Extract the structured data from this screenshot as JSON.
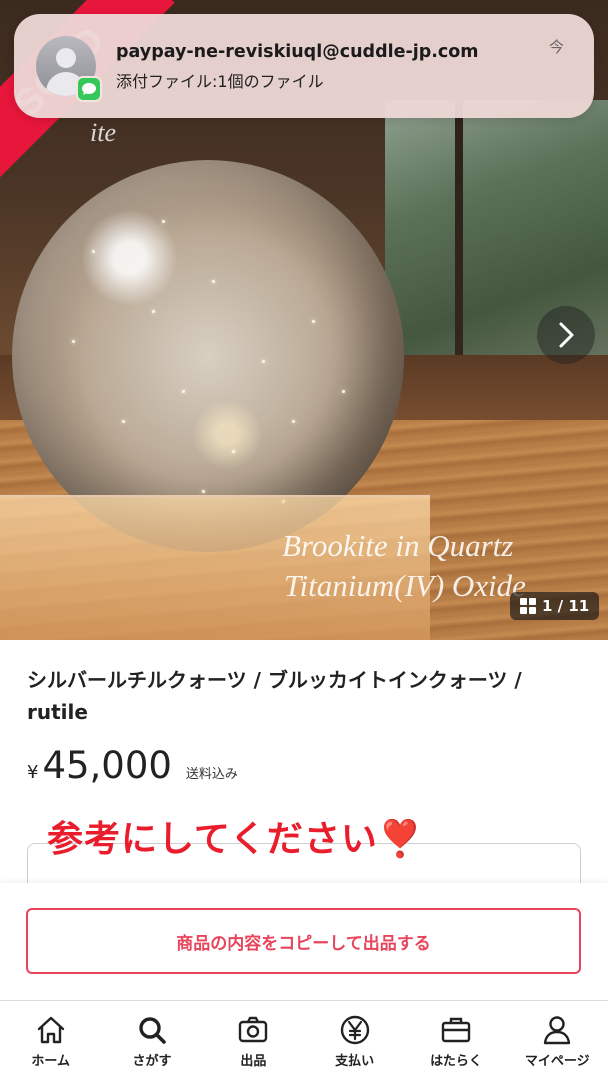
{
  "notification": {
    "sender": "paypay-ne-reviskiuql@cuddle-jp.com",
    "subject": "添付ファイル:1個のファイル",
    "time": "今",
    "app_icon": "messages-icon"
  },
  "hero": {
    "sold_ribbon": "SOLD",
    "caption_line1": "Brookite in Quartz",
    "caption_line2": "Titanium(IV) Oxide",
    "image_counter": "1 / 11"
  },
  "product": {
    "title": "シルバールチルクォーツ / ブルッカイトインクォーツ / rutile",
    "currency": "¥",
    "price": "45,000",
    "shipping": "送料込み"
  },
  "annotation": "参考にしてください❣️",
  "actions": {
    "copy_listing": "商品の内容をコピーして出品する"
  },
  "tabbar": {
    "items": [
      {
        "label": "ホーム",
        "icon": "home-icon"
      },
      {
        "label": "さがす",
        "icon": "search-icon"
      },
      {
        "label": "出品",
        "icon": "camera-icon"
      },
      {
        "label": "支払い",
        "icon": "yen-coin-icon"
      },
      {
        "label": "はたらく",
        "icon": "briefcase-icon"
      },
      {
        "label": "マイページ",
        "icon": "person-icon"
      }
    ]
  },
  "colors": {
    "accent": "#e8455c",
    "annotation_red": "#ea1d2c",
    "sold_red": "#e8163a"
  }
}
